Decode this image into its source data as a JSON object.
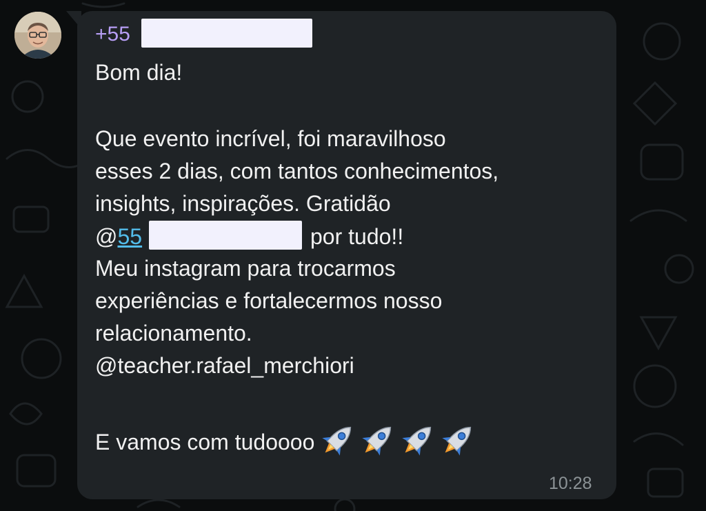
{
  "chat": {
    "sender_phone_prefix": "+55",
    "message": {
      "greeting": "Bom dia!",
      "line1": "Que evento incrível, foi maravilhoso",
      "line2": "esses 2 dias, com tantos conhecimentos,",
      "line3": "insights, inspirações. Gratidão",
      "mention_at": "@",
      "mention_prefix": "55",
      "line4_tail": "por tudo!!",
      "line5": "Meu instagram para trocarmos",
      "line6": "experiências e fortalecermos nosso",
      "line7": "relacionamento.",
      "instagram_handle": "@teacher.rafael_merchiori",
      "closing": "E vamos com tudoooo",
      "closing_emojis": [
        "rocket-icon",
        "rocket-icon",
        "rocket-icon",
        "rocket-icon"
      ]
    },
    "timestamp": "10:28"
  },
  "colors": {
    "background": "#0b0d0e",
    "bubble": "#1f2326",
    "sender_name": "#b79ef5",
    "message_text": "#f1f1f1",
    "mention_link": "#53bdeb",
    "timestamp": "#8c9396"
  }
}
